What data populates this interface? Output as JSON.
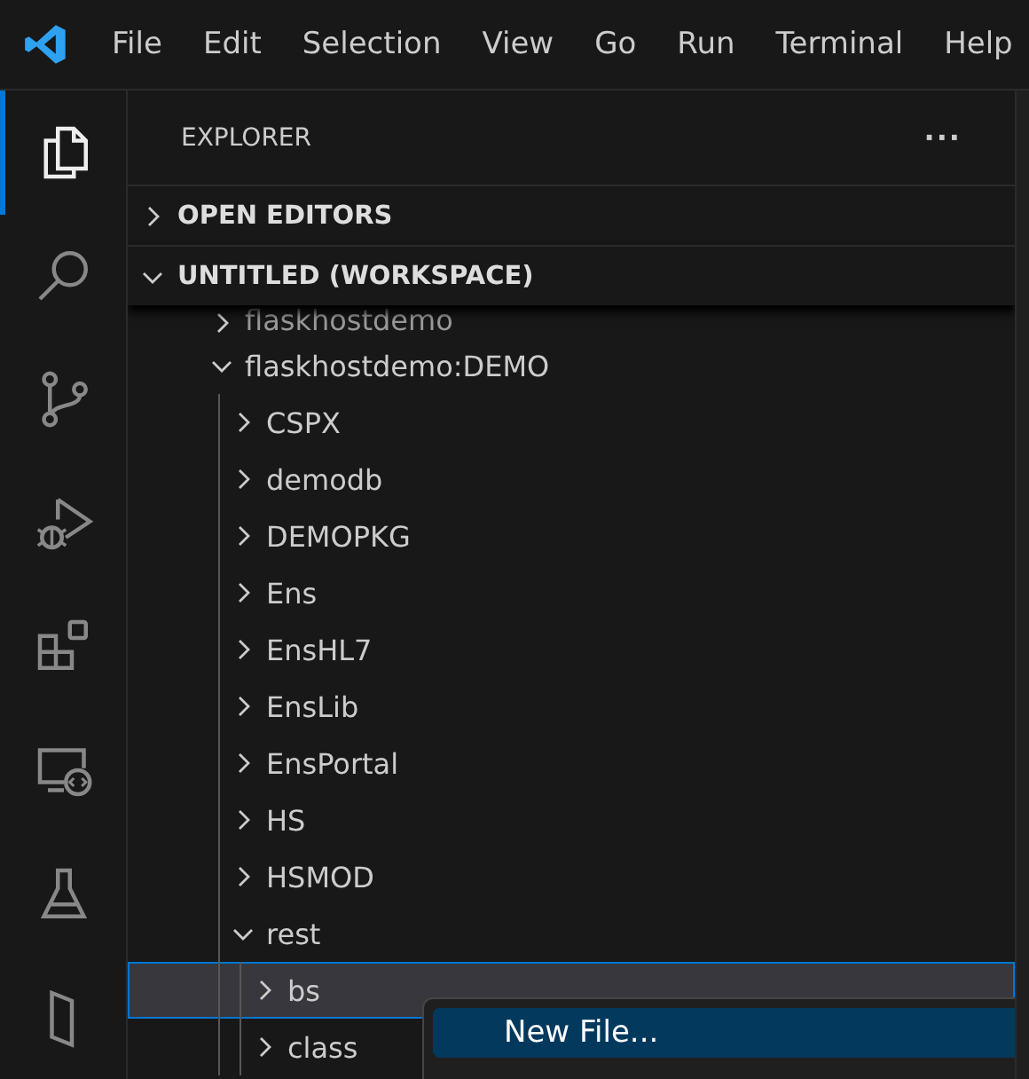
{
  "menu_bar": [
    "File",
    "Edit",
    "Selection",
    "View",
    "Go",
    "Run",
    "Terminal",
    "Help"
  ],
  "activity_bar": [
    {
      "kind": "explorer",
      "selected": true
    },
    {
      "kind": "search",
      "selected": false
    },
    {
      "kind": "source-control",
      "selected": false
    },
    {
      "kind": "debug",
      "selected": false
    },
    {
      "kind": "extensions",
      "selected": false
    },
    {
      "kind": "remote",
      "selected": false
    },
    {
      "kind": "testing",
      "selected": false
    },
    {
      "kind": "other",
      "selected": false
    }
  ],
  "sidebar": {
    "title": "EXPLORER",
    "more": "···",
    "sections": [
      {
        "label": "OPEN EDITORS",
        "expanded": false
      },
      {
        "label": "UNTITLED (WORKSPACE)",
        "expanded": true
      }
    ],
    "tree": [
      {
        "label": "flaskhostdemo",
        "expanded": false,
        "selected": false,
        "partial": true
      },
      {
        "label": "flaskhostdemo:DEMO",
        "expanded": true,
        "selected": false,
        "children": [
          {
            "label": "CSPX",
            "expanded": false,
            "selected": false
          },
          {
            "label": "demodb",
            "expanded": false,
            "selected": false
          },
          {
            "label": "DEMOPKG",
            "expanded": false,
            "selected": false
          },
          {
            "label": "Ens",
            "expanded": false,
            "selected": false
          },
          {
            "label": "EnsHL7",
            "expanded": false,
            "selected": false
          },
          {
            "label": "EnsLib",
            "expanded": false,
            "selected": false
          },
          {
            "label": "EnsPortal",
            "expanded": false,
            "selected": false
          },
          {
            "label": "HS",
            "expanded": false,
            "selected": false
          },
          {
            "label": "HSMOD",
            "expanded": false,
            "selected": false
          },
          {
            "label": "rest",
            "expanded": true,
            "selected": false,
            "children": [
              {
                "label": "bs",
                "expanded": false,
                "selected": true
              },
              {
                "label": "class",
                "expanded": false,
                "selected": false
              }
            ]
          }
        ]
      }
    ]
  },
  "context_menu": {
    "items": [
      {
        "label": "New File...",
        "selected": true
      }
    ]
  }
}
